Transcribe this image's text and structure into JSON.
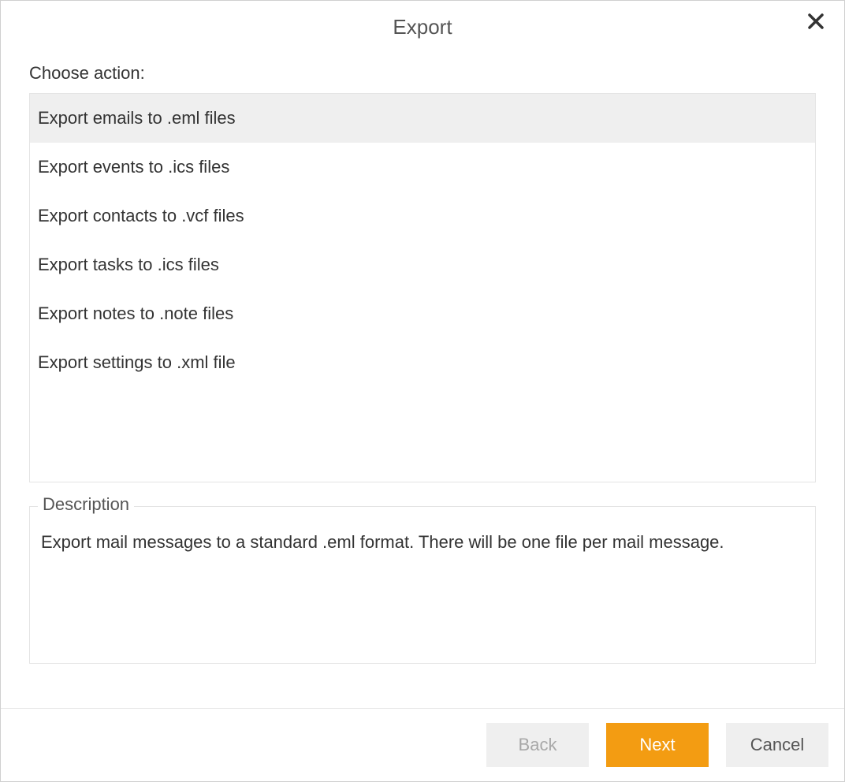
{
  "dialog": {
    "title": "Export",
    "choose_label": "Choose action:",
    "actions": [
      {
        "label": "Export emails to .eml files",
        "selected": true
      },
      {
        "label": "Export events to .ics files",
        "selected": false
      },
      {
        "label": "Export contacts to .vcf files",
        "selected": false
      },
      {
        "label": "Export tasks to .ics files",
        "selected": false
      },
      {
        "label": "Export notes to .note files",
        "selected": false
      },
      {
        "label": "Export settings to .xml file",
        "selected": false
      }
    ],
    "description": {
      "legend": "Description",
      "text": "Export mail messages to a standard .eml format. There will be one file per mail message."
    },
    "buttons": {
      "back": "Back",
      "next": "Next",
      "cancel": "Cancel"
    },
    "colors": {
      "primary": "#f39c12",
      "secondary_bg": "#efefef",
      "border": "#e4e4e4"
    }
  }
}
